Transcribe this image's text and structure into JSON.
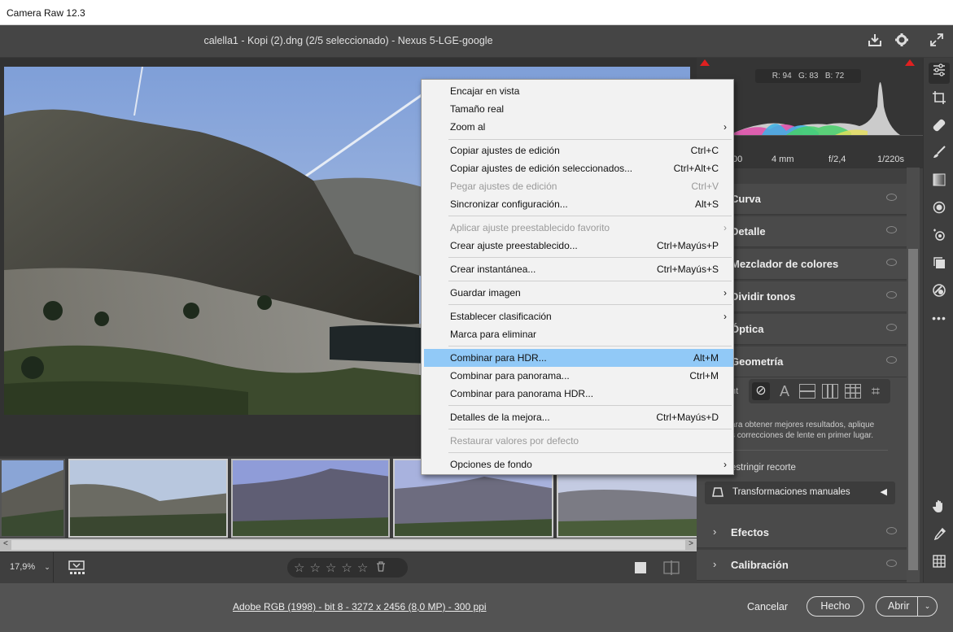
{
  "window": {
    "title": "Camera Raw 12.3"
  },
  "header": {
    "file_info": "calella1 - Kopi (2).dng (2/5 seleccionado) -  Nexus 5-LGE-google"
  },
  "histogram": {
    "r": "R: 94",
    "g": "G: 83",
    "b": "B: 72"
  },
  "exif": {
    "iso": "00",
    "focal": "4 mm",
    "aperture": "f/2,4",
    "shutter": "1/220s"
  },
  "panel": {
    "sections": [
      {
        "label": "Curva"
      },
      {
        "label": "Detalle"
      },
      {
        "label": "Mezclador de colores"
      },
      {
        "label": "Dividir tonos"
      },
      {
        "label": "Óptica"
      },
      {
        "label": "Geometría"
      }
    ],
    "upright_label": "nt",
    "hint_line1": "ara obtener mejores resultados, aplique",
    "hint_line2": "s correcciones de lente en primer lugar.",
    "restrict_crop": "estringir recorte",
    "manual_transforms": "Transformaciones manuales",
    "effects": "Efectos",
    "calibration": "Calibración"
  },
  "context_menu": {
    "items": [
      {
        "label": "Encajar en vista",
        "shortcut": ""
      },
      {
        "label": "Tamaño real",
        "shortcut": ""
      },
      {
        "label": "Zoom al",
        "shortcut": ""
      },
      {
        "label": "Copiar ajustes de edición",
        "shortcut": "Ctrl+C"
      },
      {
        "label": "Copiar ajustes de edición seleccionados...",
        "shortcut": "Ctrl+Alt+C"
      },
      {
        "label": "Pegar ajustes de edición",
        "shortcut": "Ctrl+V"
      },
      {
        "label": "Sincronizar configuración...",
        "shortcut": "Alt+S"
      },
      {
        "label": "Aplicar ajuste preestablecido favorito",
        "shortcut": ""
      },
      {
        "label": "Crear ajuste preestablecido...",
        "shortcut": "Ctrl+Mayús+P"
      },
      {
        "label": "Crear instantánea...",
        "shortcut": "Ctrl+Mayús+S"
      },
      {
        "label": "Guardar imagen",
        "shortcut": ""
      },
      {
        "label": "Establecer clasificación",
        "shortcut": ""
      },
      {
        "label": "Marca para eliminar",
        "shortcut": ""
      },
      {
        "label": "Combinar para HDR...",
        "shortcut": "Alt+M"
      },
      {
        "label": "Combinar para panorama...",
        "shortcut": "Ctrl+M"
      },
      {
        "label": "Combinar para panorama HDR...",
        "shortcut": ""
      },
      {
        "label": "Detalles de la mejora...",
        "shortcut": "Ctrl+Mayús+D"
      },
      {
        "label": "Restaurar valores por defecto",
        "shortcut": ""
      },
      {
        "label": "Opciones de fondo",
        "shortcut": ""
      }
    ]
  },
  "bottom": {
    "zoom": "17,9%",
    "file_details": "Adobe RGB (1998) - bit 8 - 3272 x 2456 (8,0 MP) - 300 ppi",
    "cancel": "Cancelar",
    "done": "Hecho",
    "open": "Abrir"
  },
  "icons": {
    "chevron": "›",
    "star": "☆",
    "trash": "🗑"
  }
}
